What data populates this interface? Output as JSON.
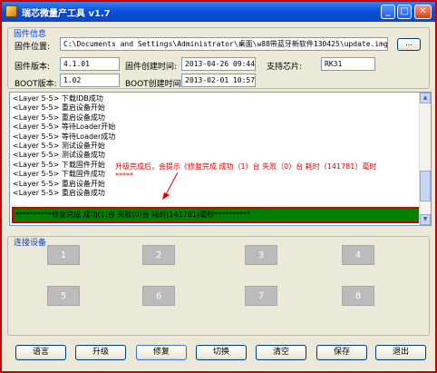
{
  "window": {
    "title": "瑞芯微量产工具 v1.7",
    "minimize": "_",
    "maximize": "□",
    "close": "✕"
  },
  "firmware": {
    "group_title": "固件信息",
    "location_label": "固件位置:",
    "location_value": "C:\\Documents and Settings\\Administrator\\桌面\\w88带蓝牙新软件130425\\update.img",
    "browse_label": "...",
    "version_label": "固件版本:",
    "version_value": "4.1.01",
    "created_label": "固件创建时间:",
    "created_value": "2013-04-26 09:44:53",
    "chip_label": "支持芯片:",
    "chip_value": "RK31",
    "boot_version_label": "BOOT版本:",
    "boot_version_value": "1.02",
    "boot_created_label": "BOOT创建时间:",
    "boot_created_value": "2013-02-01 10:57:34"
  },
  "log": {
    "lines": [
      "<Layer 5-5> 下载IDB成功",
      "<Layer 5-5> 重启设备开始",
      "<Layer 5-5> 重启设备成功",
      "<Layer 5-5> 等待Loader开始",
      "<Layer 5-5> 等待Loader成功",
      "<Layer 5-5> 测试设备开始",
      "<Layer 5-5> 测试设备成功",
      "<Layer 5-5> 下载固件开始",
      "<Layer 5-5> 下载固件成功",
      "<Layer 5-5> 重启设备开始",
      "<Layer 5-5> 重启设备成功"
    ],
    "status": "**********修复完成 成功(1)台 失败(0)台 耗时(141781)毫秒**********",
    "annotation": "升级完成后，会提示《修复完成 成功（1）台 失败（0）台 耗时（141781）毫时",
    "annotation2": "*****",
    "status_bg": "#008000",
    "annotation_color": "#e00000"
  },
  "devices": {
    "group_title": "连接设备",
    "slots": [
      "1",
      "2",
      "3",
      "4",
      "5",
      "6",
      "7",
      "8"
    ]
  },
  "buttons": {
    "language": "语言",
    "upgrade": "升级",
    "repair": "修复",
    "switch": "切换",
    "clear": "清空",
    "save": "保存",
    "exit": "退出"
  }
}
